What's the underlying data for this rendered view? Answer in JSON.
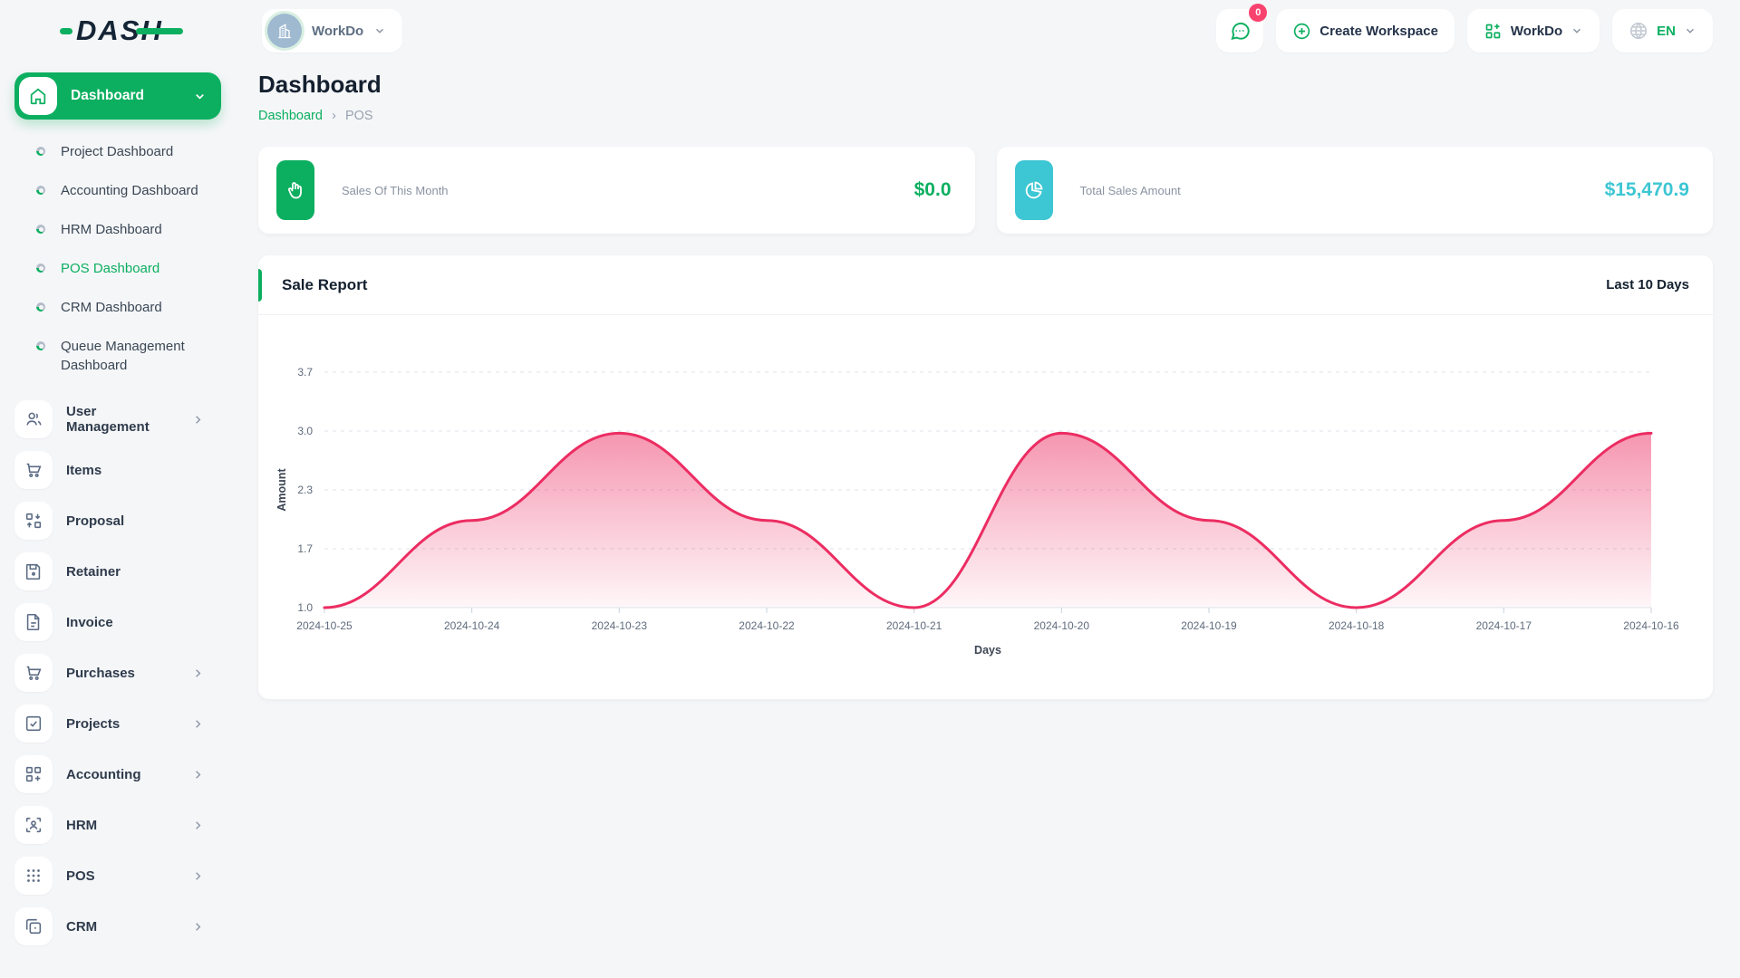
{
  "colors": {
    "accent_green": "#0caf60",
    "badge_pink": "#f9436f",
    "cyan": "#3dc6d3",
    "line_pink": "#ec2d62",
    "icon_slate": "#5b6b84",
    "axis_text": "#5f6b7c"
  },
  "logo": {
    "text": "DASH"
  },
  "topbar": {
    "workspace": {
      "name": "WorkDo",
      "avatar_icon": "building-icon"
    },
    "messages_badge": "0",
    "create_workspace_label": "Create Workspace",
    "workspace_menu_label": "WorkDo",
    "language": "EN"
  },
  "sidebar": {
    "dashboard_group": {
      "label": "Dashboard",
      "children": [
        {
          "label": "Project Dashboard",
          "active": false
        },
        {
          "label": "Accounting Dashboard",
          "active": false
        },
        {
          "label": "HRM Dashboard",
          "active": false
        },
        {
          "label": "POS Dashboard",
          "active": true
        },
        {
          "label": "CRM Dashboard",
          "active": false
        },
        {
          "label": "Queue Management Dashboard",
          "active": false
        }
      ]
    },
    "items": [
      {
        "label": "User Management",
        "icon": "users-icon",
        "expandable": true
      },
      {
        "label": "Items",
        "icon": "cart-icon",
        "expandable": false
      },
      {
        "label": "Proposal",
        "icon": "transfer-icon",
        "expandable": false
      },
      {
        "label": "Retainer",
        "icon": "save-icon",
        "expandable": false
      },
      {
        "label": "Invoice",
        "icon": "file-icon",
        "expandable": false
      },
      {
        "label": "Purchases",
        "icon": "cart-icon",
        "expandable": true
      },
      {
        "label": "Projects",
        "icon": "check-square-icon",
        "expandable": true
      },
      {
        "label": "Accounting",
        "icon": "grid-plus-icon",
        "expandable": true
      },
      {
        "label": "HRM",
        "icon": "user-scan-icon",
        "expandable": true
      },
      {
        "label": "POS",
        "icon": "dots-grid-icon",
        "expandable": true
      },
      {
        "label": "CRM",
        "icon": "copy-icon",
        "expandable": true
      }
    ]
  },
  "page": {
    "title": "Dashboard",
    "breadcrumb": {
      "link": "Dashboard",
      "current": "POS"
    }
  },
  "stat_cards": [
    {
      "label": "Sales Of This Month",
      "value": "$0.0",
      "color": "#0caf60",
      "icon": "click-hand-icon"
    },
    {
      "label": "Total Sales Amount",
      "value": "$15,470.9",
      "color": "#3dc6d3",
      "icon": "pie-chart-icon"
    }
  ],
  "chart_data": {
    "type": "area",
    "title": "Sale Report",
    "subtitle": "Last 10 Days",
    "xlabel": "Days",
    "ylabel": "Amount",
    "x": [
      "2024-10-25",
      "2024-10-24",
      "2024-10-23",
      "2024-10-22",
      "2024-10-21",
      "2024-10-20",
      "2024-10-19",
      "2024-10-18",
      "2024-10-17",
      "2024-10-16"
    ],
    "series": [
      {
        "name": "Amount",
        "values": [
          1,
          2,
          3,
          2,
          1,
          3,
          2,
          1,
          2,
          3
        ]
      }
    ],
    "ytick_labels": [
      "1.0",
      "1.7",
      "2.3",
      "3.0",
      "3.7"
    ],
    "ylim": [
      1.0,
      3.7
    ],
    "grid": "dashed-horizontal",
    "line_color": "#ec2d62",
    "smooth": true
  }
}
